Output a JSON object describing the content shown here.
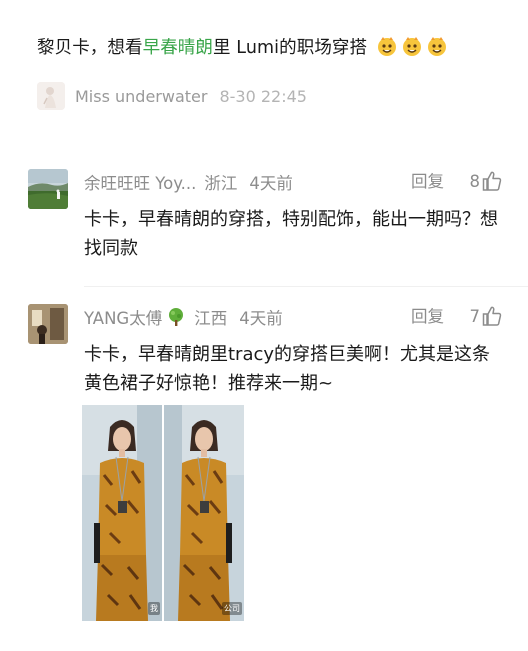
{
  "post": {
    "title_before": "黎贝卡，想看",
    "title_highlight": "早春晴朗",
    "title_after": "里 Lumi的职场穿搭",
    "emoji_icon": "sparkle-face-emoji",
    "highlight_color": "#3aa54a",
    "author": "Miss underwater",
    "time": "8-30 22:45"
  },
  "comments": [
    {
      "name": "余旺旺旺 Yoy...",
      "location": "浙江",
      "ago": "4天前",
      "reply": "回复",
      "likes": "8",
      "text": "卡卡，早春晴朗的穿搭，特别配饰，能出一期吗？想找同款"
    },
    {
      "name": "YANG太傅",
      "name_emoji": "tree-emoji",
      "location": "江西",
      "ago": "4天前",
      "reply": "回复",
      "likes": "7",
      "text": "卡卡，早春晴朗里tracy的穿搭巨美啊！尤其是这条黄色裙子好惊艳！推荐来一期~",
      "image_watermarks": [
        "我",
        "公司"
      ]
    }
  ]
}
